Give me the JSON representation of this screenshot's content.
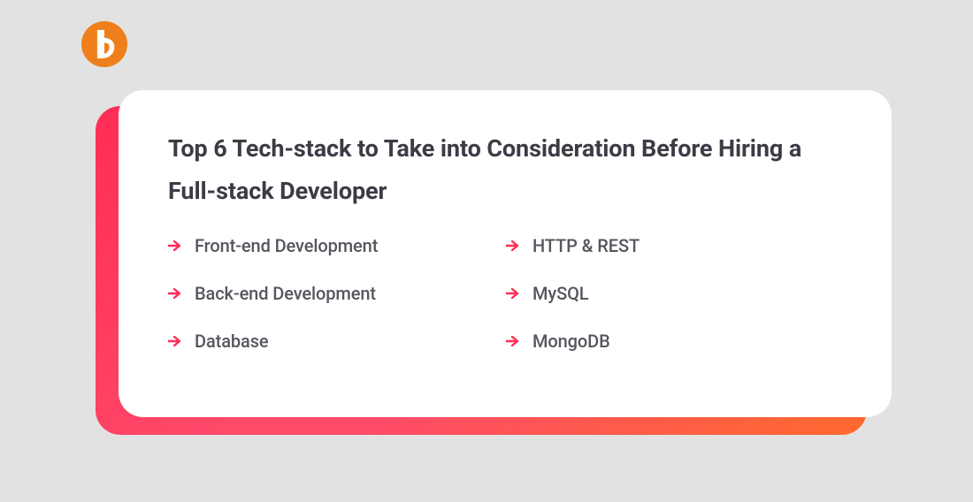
{
  "colors": {
    "background": "#e2e2e2",
    "logo": "#ef7f1a",
    "accent": "#ff2d55",
    "heading": "#3b3c45",
    "body": "#55565e",
    "card": "#ffffff"
  },
  "card": {
    "title": "Top 6 Tech-stack to Take into Consideration Before Hiring a Full-stack Developer",
    "columns": [
      {
        "items": [
          {
            "label": "Front-end Development"
          },
          {
            "label": "Back-end Development"
          },
          {
            "label": "Database"
          }
        ]
      },
      {
        "items": [
          {
            "label": "HTTP & REST"
          },
          {
            "label": "MySQL"
          },
          {
            "label": "MongoDB"
          }
        ]
      }
    ]
  }
}
